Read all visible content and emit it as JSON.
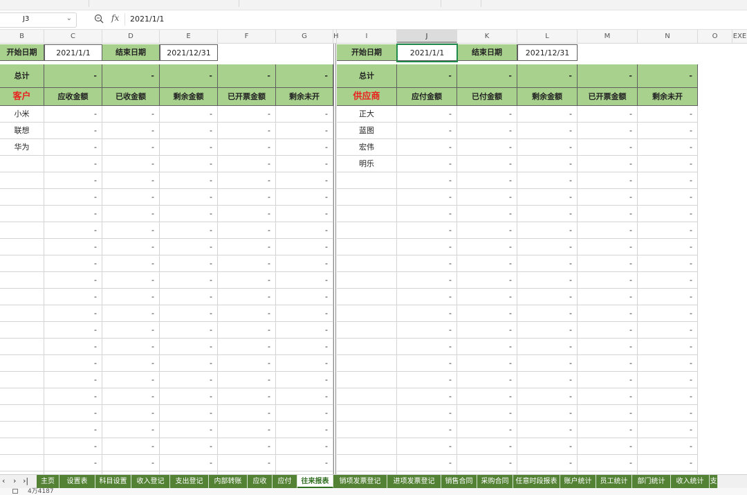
{
  "formula_bar": {
    "cell_ref": "J3",
    "formula_value": "2021/1/1",
    "fx_symbol": "fx"
  },
  "columns": [
    "B",
    "C",
    "D",
    "E",
    "F",
    "G",
    "H",
    "I",
    "J",
    "K",
    "L",
    "M",
    "N",
    "O",
    "EXE"
  ],
  "left_table": {
    "start_label": "开始日期",
    "start_value": "2021/1/1",
    "end_label": "结束日期",
    "end_value": "2021/12/31",
    "total_label": "总计",
    "header_first": "客户",
    "headers": [
      "应收金额",
      "已收金额",
      "剩余金额",
      "已开票金额",
      "剩余未开"
    ],
    "names": [
      "小米",
      "联想",
      "华为"
    ]
  },
  "right_table": {
    "start_label": "开始日期",
    "start_value": "2021/1/1",
    "end_label": "结束日期",
    "end_value": "2021/12/31",
    "total_label": "总计",
    "header_first": "供应商",
    "headers": [
      "应付金额",
      "已付金额",
      "剩余金额",
      "已开票金额",
      "剩余未开"
    ],
    "names": [
      "正大",
      "蓝图",
      "宏伟",
      "明乐"
    ]
  },
  "dash": "-",
  "sheet_tabs": [
    "主页",
    "设置表",
    "科目设置",
    "收入登记",
    "支出登记",
    "内部转账",
    "应收",
    "应付",
    "往来报表",
    "销项发票登记",
    "进项发票登记",
    "销售合同",
    "采购合同",
    "任意时段报表",
    "账户统计",
    "员工统计",
    "部门统计",
    "收入统计",
    "支"
  ],
  "active_tab": "往来报表",
  "nav_buttons": [
    "‹",
    "›",
    "›|"
  ],
  "status_text": "4万4187"
}
